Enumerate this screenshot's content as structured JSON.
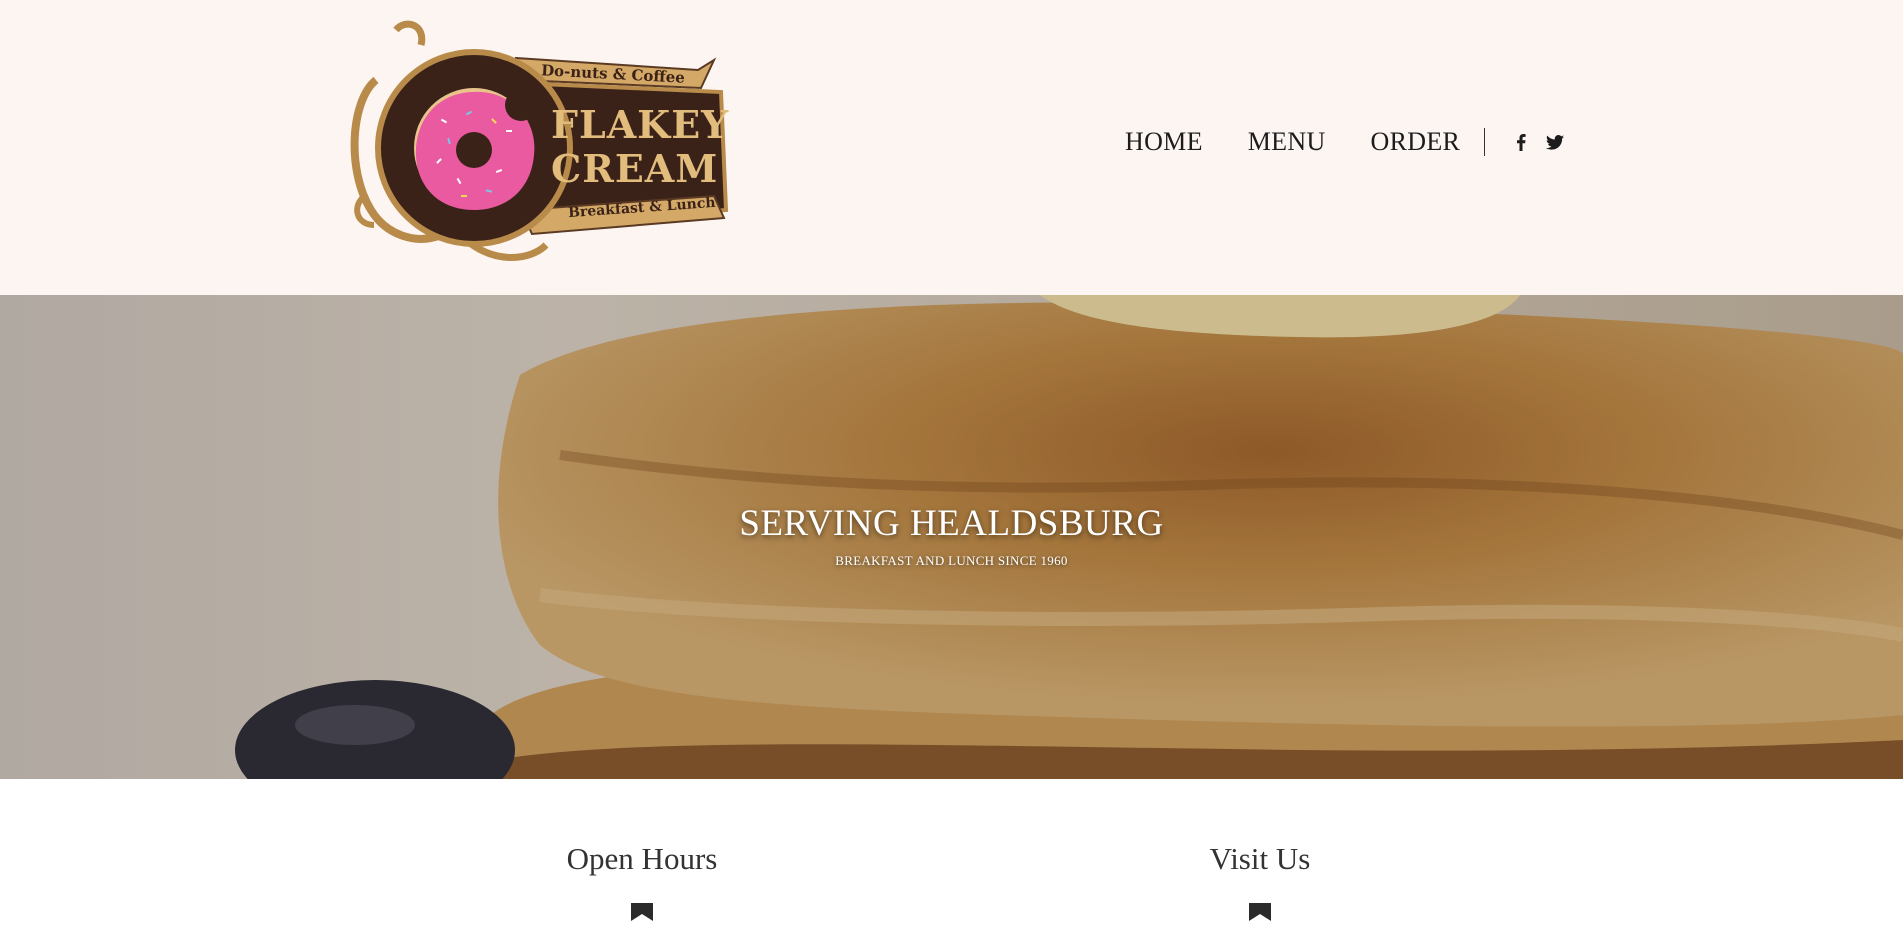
{
  "logo": {
    "top_banner": "Do-nuts & Coffee",
    "line1": "FLAKEY",
    "line2": "CREAM",
    "bottom_banner": "Breakfast & Lunch"
  },
  "nav": {
    "items": [
      {
        "label": "HOME"
      },
      {
        "label": "MENU"
      },
      {
        "label": "ORDER"
      }
    ],
    "social": [
      "facebook-icon",
      "twitter-icon"
    ]
  },
  "hero": {
    "title": "SERVING HEALDSBURG",
    "subtitle": "BREAKFAST AND LUNCH SINCE 1960"
  },
  "info": {
    "hours_title": "Open Hours",
    "visit_title": "Visit Us",
    "marker_icon": "bookmark-icon"
  },
  "colors": {
    "header_bg": "#fdf5f1",
    "logo_brown": "#3a2218",
    "logo_gold": "#c9a063",
    "donut_pink": "#ea5aa0"
  }
}
